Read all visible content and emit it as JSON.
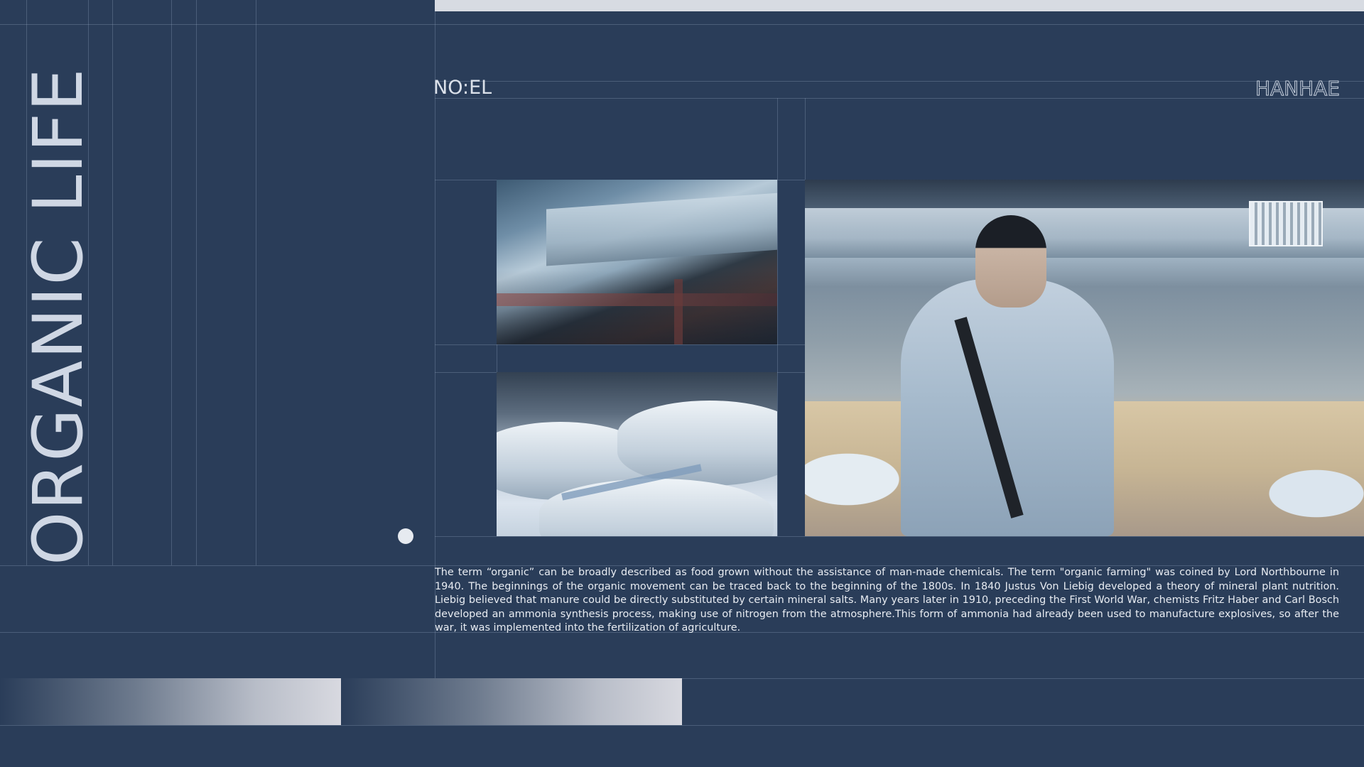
{
  "slide": {
    "vertical_title": "ORGANIC LIFE",
    "brand_left": "NO:EL",
    "brand_right": "HANHAE",
    "body_text": "The term “organic” can be broadly described as food grown without the assistance of man-made chemicals. The term \"organic farming\" was coined by Lord Northbourne in 1940. The beginnings of the organic movement can be traced back to the beginning of the 1800s. In 1840 Justus Von Liebig developed a theory of mineral plant nutrition. Liebig believed that manure could be directly substituted by certain mineral salts. Many years later in 1910, preceding the First World War, chemists Fritz Haber and Carl Bosch developed an ammonia synthesis process, making use of nitrogen from the atmosphere.This form of ammonia had already been used to manufacture explosives, so after the war, it was implemented into the fertilization of agriculture."
  },
  "colors": {
    "background": "#2a3d59",
    "text": "#e8ecf2",
    "accent_light": "#d7dbe2"
  }
}
